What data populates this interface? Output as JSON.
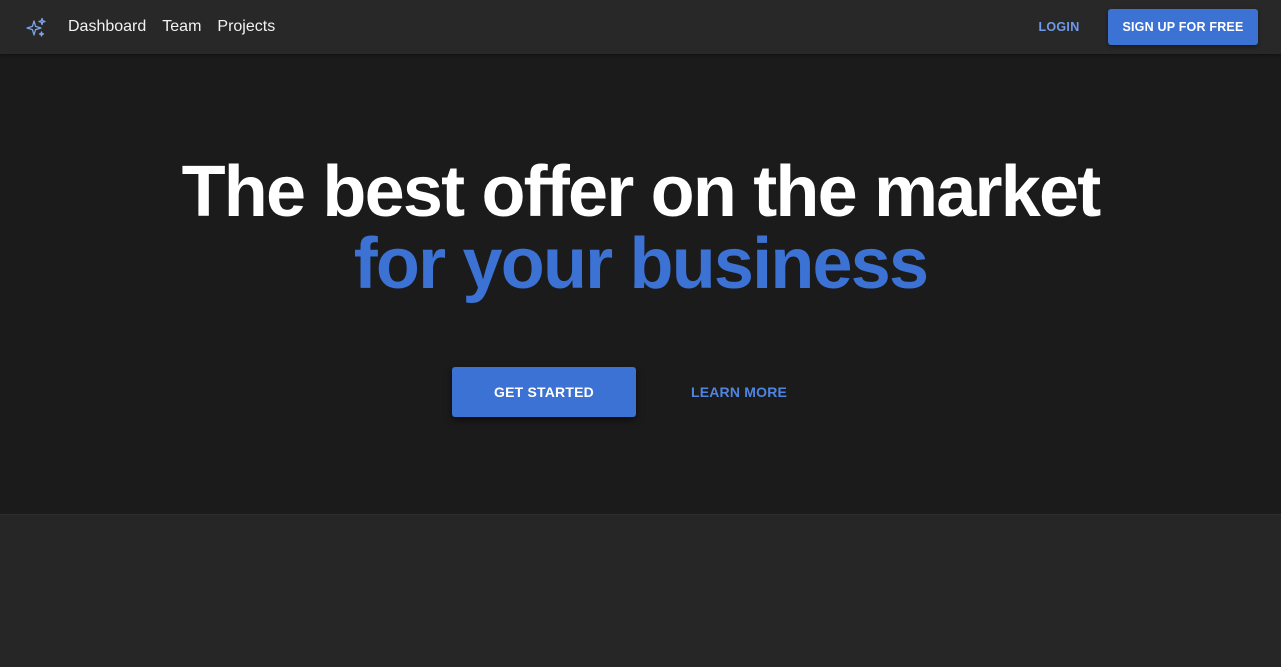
{
  "navbar": {
    "brand_icon": "sparkles-icon",
    "links": [
      {
        "label": "Dashboard"
      },
      {
        "label": "Team"
      },
      {
        "label": "Projects"
      }
    ],
    "login_label": "LOGIN",
    "signup_label": "SIGN UP FOR FREE"
  },
  "hero": {
    "title_line_1": "The best offer on the market",
    "title_line_2": "for your business",
    "primary_button_label": "GET STARTED",
    "secondary_button_label": "LEARN MORE"
  },
  "colors": {
    "accent": "#3b72d4",
    "navbar_background": "#282828",
    "hero_background": "#1b1b1c",
    "page_background": "#262626",
    "text_primary": "#ffffff"
  }
}
